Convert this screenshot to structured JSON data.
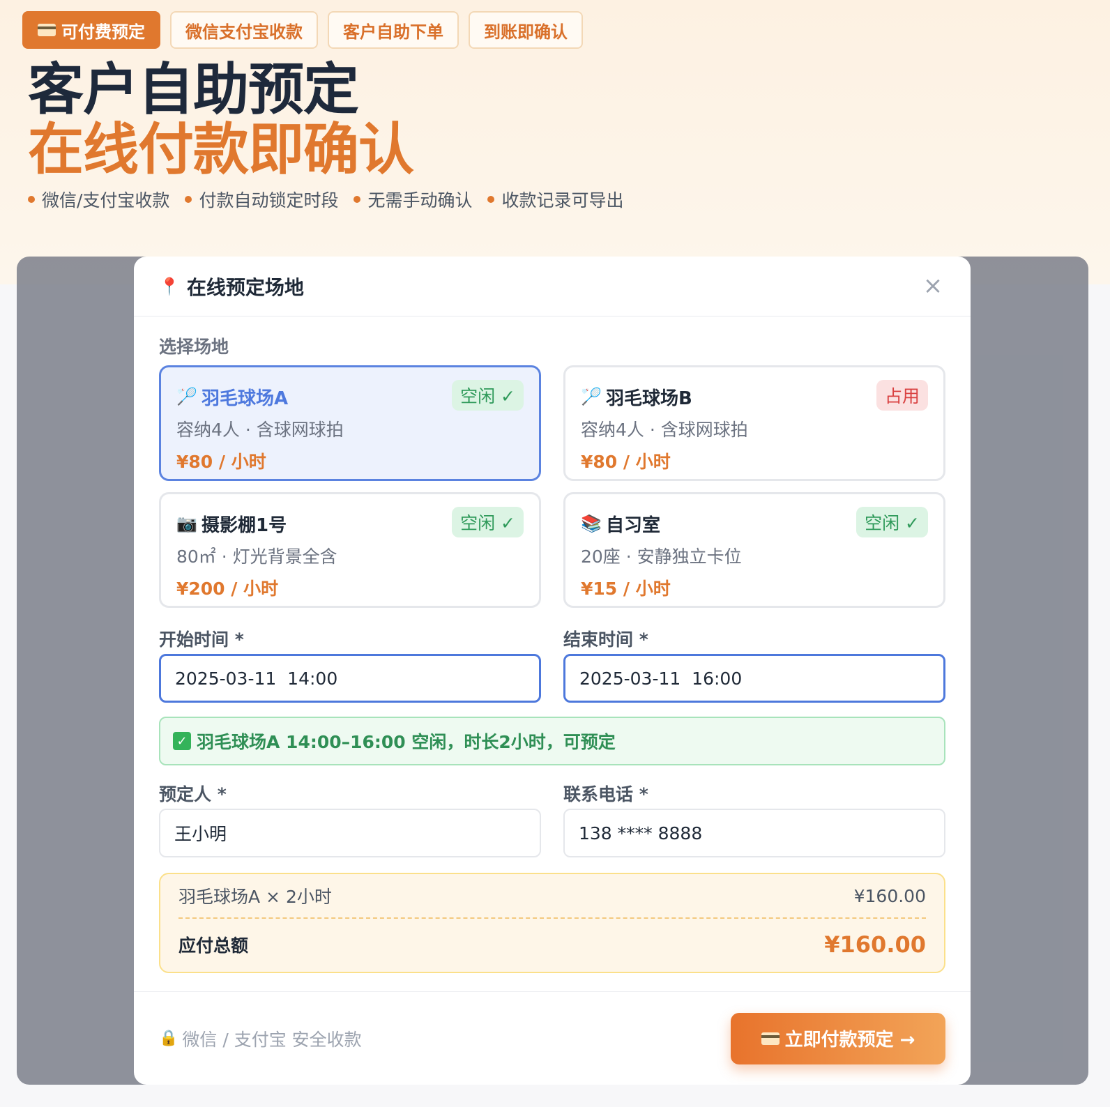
{
  "colors": {
    "accent": "#e0782e",
    "select_blue": "#5b83e0",
    "free_green": "#2f9a5a",
    "busy_red": "#d94040"
  },
  "hero": {
    "tags": [
      "可付费预定",
      "微信支付宝收款",
      "客户自助下单",
      "到账即确认"
    ],
    "title_line1": "客户自助预定",
    "title_line2": "在线付款即确认",
    "features": [
      "微信/支付宝收款",
      "付款自动锁定时段",
      "无需手动确认",
      "收款记录可导出"
    ]
  },
  "modal": {
    "title": "在线预定场地",
    "close_label": "×",
    "venue_section_label": "选择场地",
    "venues": [
      {
        "icon": "🏸",
        "name": "羽毛球场A",
        "status": "空闲 ✓",
        "desc": "容纳4人 · 含球网球拍",
        "price": "¥80 / 小时",
        "selected": true
      },
      {
        "icon": "🏸",
        "name": "羽毛球场B",
        "status": "占用",
        "desc": "容纳4人 · 含球网球拍",
        "price": "¥80 / 小时",
        "selected": false
      },
      {
        "icon": "📷",
        "name": "摄影棚1号",
        "status": "空闲 ✓",
        "desc": "80㎡ · 灯光背景全含",
        "price": "¥200 / 小时",
        "selected": false
      },
      {
        "icon": "📚",
        "name": "自习室",
        "status": "空闲 ✓",
        "desc": "20座 · 安静独立卡位",
        "price": "¥15 / 小时",
        "selected": false
      }
    ],
    "start_label": "开始时间 *",
    "start_value": "2025-03-11  14:00",
    "end_label": "结束时间 *",
    "end_value": "2025-03-11  16:00",
    "availability_msg": "羽毛球场A 14:00–16:00 空闲，时长2小时，可预定",
    "booker_label": "预定人 *",
    "booker_value": "王小明",
    "phone_label": "联系电话 *",
    "phone_value": "138 **** 8888",
    "summary": {
      "line_label": "羽毛球场A × 2小时",
      "line_value": "¥160.00",
      "total_label": "应付总额",
      "total_value": "¥160.00"
    },
    "secure_note": "微信 / 支付宝 安全收款",
    "pay_button": "立即付款预定 →"
  }
}
